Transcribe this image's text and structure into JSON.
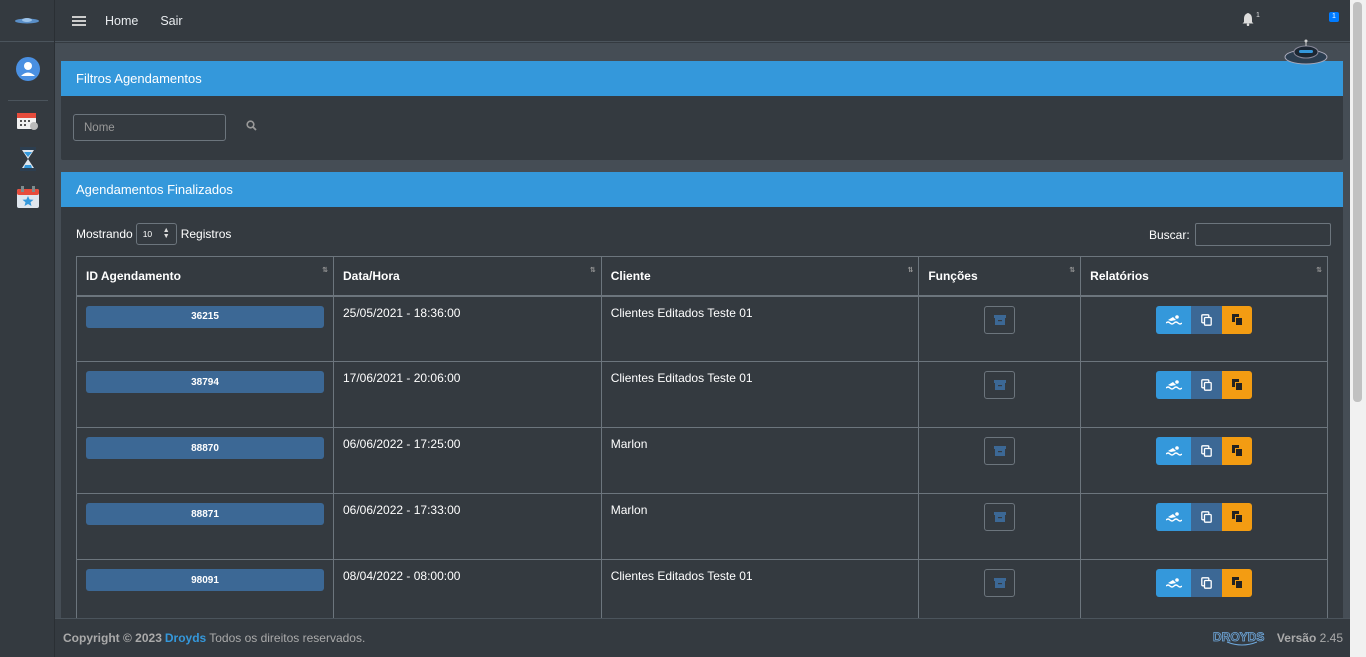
{
  "topbar": {
    "nav": [
      "Home",
      "Sair"
    ],
    "notifications_count": "1",
    "user_badge": "1"
  },
  "filter_card": {
    "title": "Filtros Agendamentos",
    "name_placeholder": "Nome"
  },
  "list_card": {
    "title": "Agendamentos Finalizados",
    "showing_label": "Mostrando",
    "page_length": "10",
    "records_label": "Registros",
    "search_label": "Buscar:"
  },
  "table": {
    "headers": [
      "ID Agendamento",
      "Data/Hora",
      "Cliente",
      "Funções",
      "Relatórios"
    ],
    "rows": [
      {
        "id": "36215",
        "datetime": "25/05/2021 - 18:36:00",
        "client": "Clientes Editados Teste 01"
      },
      {
        "id": "38794",
        "datetime": "17/06/2021 - 20:06:00",
        "client": "Clientes Editados Teste 01"
      },
      {
        "id": "88870",
        "datetime": "06/06/2022 - 17:25:00",
        "client": "Marlon"
      },
      {
        "id": "88871",
        "datetime": "06/06/2022 - 17:33:00",
        "client": "Marlon"
      },
      {
        "id": "98091",
        "datetime": "08/04/2022 - 08:00:00",
        "client": "Clientes Editados Teste 01"
      }
    ]
  },
  "footer": {
    "copyright": "Copyright © 2023",
    "brand": "Droyds",
    "rights": "Todos os direitos reservados.",
    "version_label": "Versão",
    "version": "2.45",
    "logo_text": "DROYDS"
  },
  "colors": {
    "primary": "#3498db",
    "background": "#343a40",
    "content": "#454d55",
    "id_pill": "#3c6895",
    "warning": "#f39c12"
  },
  "icons": [
    "menu-icon",
    "bell-icon",
    "user-avatar-icon",
    "calendar-icon",
    "hourglass-icon",
    "calendar-star-icon",
    "search-icon",
    "sort-icon",
    "archive-icon",
    "swimmer-icon",
    "copy-icon",
    "copy-alt-icon"
  ]
}
